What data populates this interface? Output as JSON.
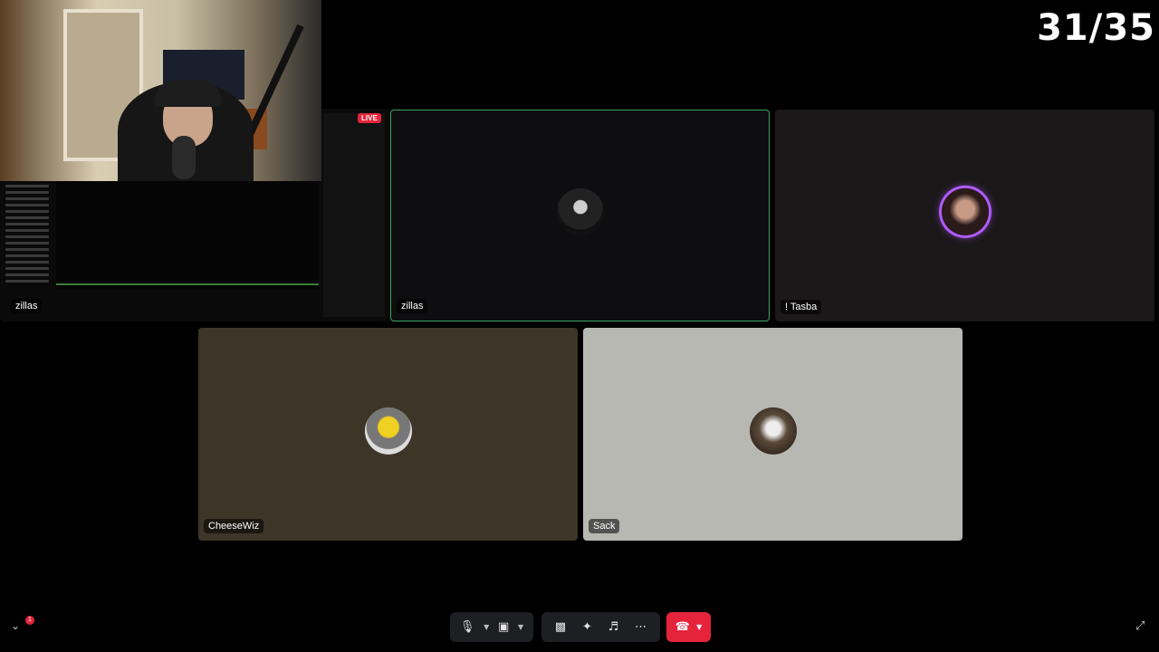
{
  "counter": "31/35",
  "screen_share": {
    "live_label": "LIVE",
    "presenter_name": "zillas"
  },
  "tiles": [
    {
      "name": "zillas",
      "bg": "#0e0e10",
      "speaking": true
    },
    {
      "name": "! Tasba",
      "bg": "#1a1819",
      "ring": "#b05bff"
    },
    {
      "name": "CheeseWiz",
      "bg": "#3d3527"
    },
    {
      "name": "Sack",
      "bg": "#b7b8b2"
    }
  ],
  "controls": {
    "mic_icon": "microphone-icon",
    "camera_icon": "camera-off-icon",
    "share_icon": "screen-share-icon",
    "activities_icon": "activities-icon",
    "soundboard_icon": "soundboard-icon",
    "more_icon": "more-icon",
    "hangup_icon": "hangup-icon",
    "hangup_color": "#e5243b"
  },
  "notification_count": "1"
}
